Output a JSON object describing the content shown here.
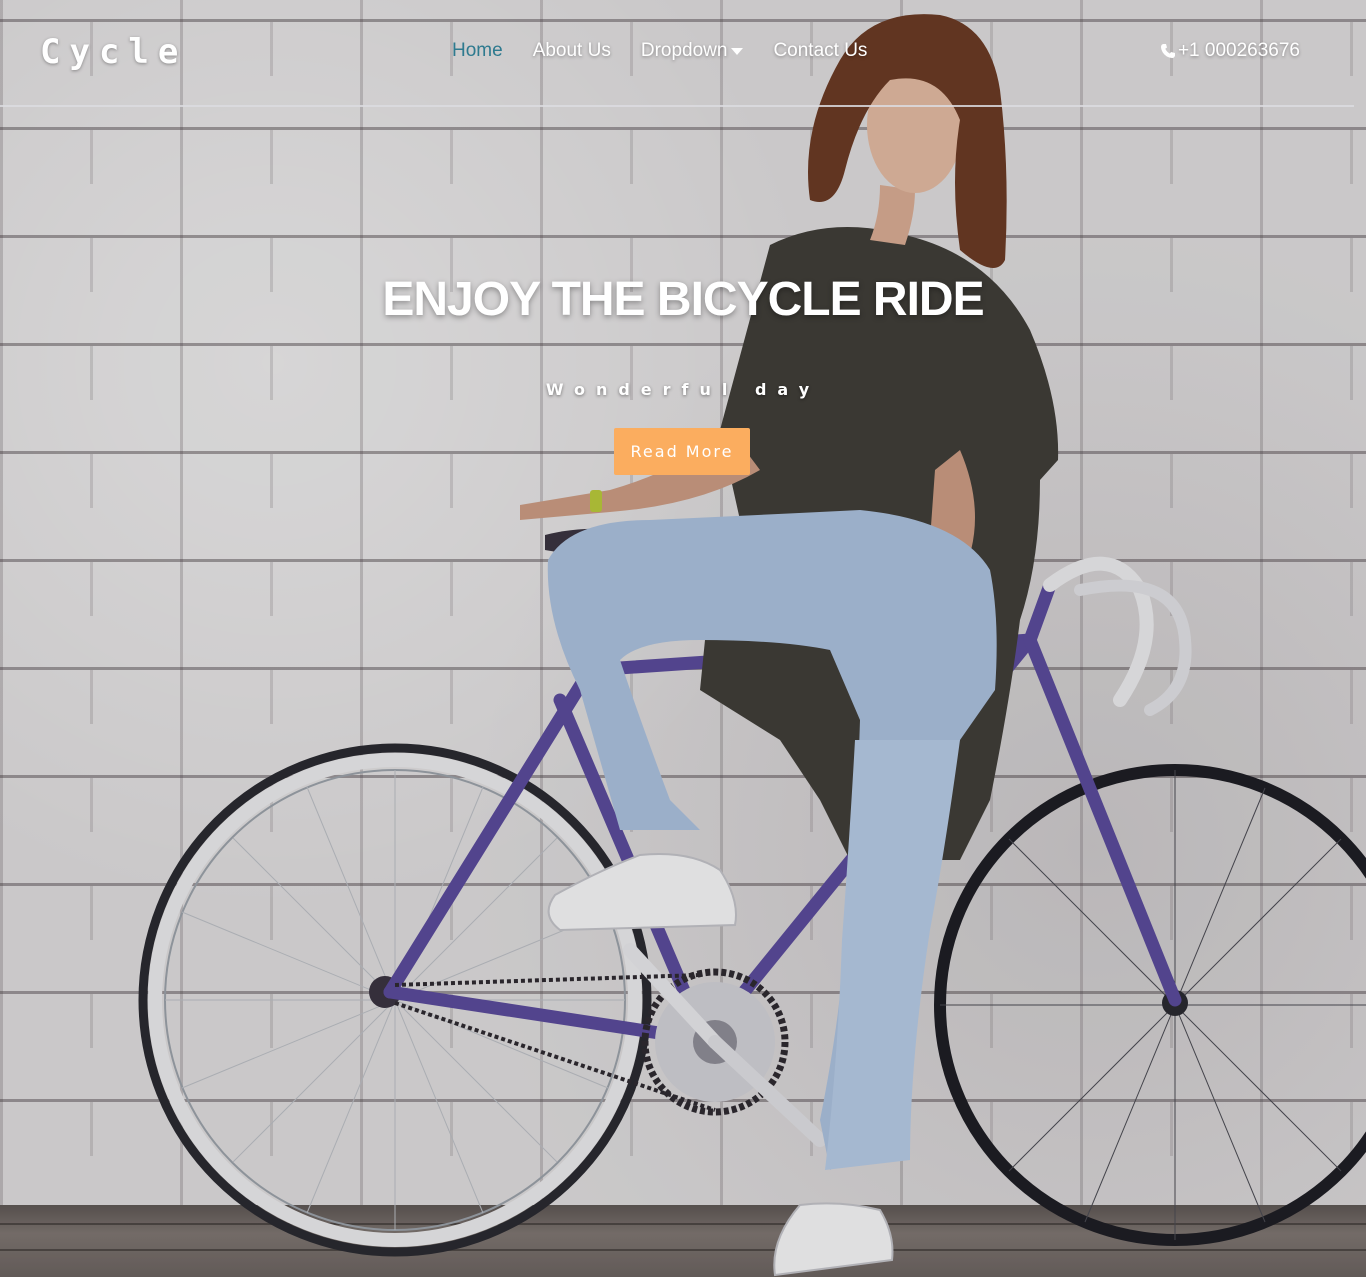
{
  "brand": {
    "logo": "Cycle"
  },
  "nav": {
    "items": [
      {
        "label": "Home",
        "active": true
      },
      {
        "label": "About Us",
        "active": false
      },
      {
        "label": "Dropdown",
        "active": false,
        "has_dropdown": true
      },
      {
        "label": "Contact Us",
        "active": false
      }
    ],
    "phone": "+1 000263676",
    "phone_icon": "phone-icon"
  },
  "hero": {
    "title": "ENJOY THE BICYCLE RIDE",
    "subtitle": "Wonderful day",
    "button_label": "Read More"
  },
  "colors": {
    "accent_active": "#2e7a8f",
    "button": "#fbad5f",
    "text": "#ffffff"
  }
}
